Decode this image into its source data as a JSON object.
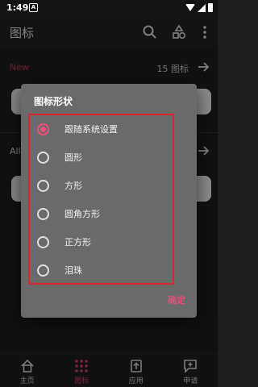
{
  "status_bar": {
    "time": "1:49",
    "notification": "A"
  },
  "app_bar": {
    "title": "图标"
  },
  "background": {
    "new_section": {
      "label": "New",
      "count": "15 图标"
    },
    "all_section": {
      "label": "All"
    }
  },
  "dialog": {
    "title": "图标形状",
    "options": [
      {
        "label": "跟随系统设置",
        "checked": true
      },
      {
        "label": "圆形",
        "checked": false
      },
      {
        "label": "方形",
        "checked": false
      },
      {
        "label": "圆角方形",
        "checked": false
      },
      {
        "label": "正方形",
        "checked": false
      },
      {
        "label": "泪珠",
        "checked": false
      }
    ],
    "ok_label": "确定"
  },
  "bottom_nav": {
    "items": [
      {
        "label": "主页",
        "icon": "home-icon"
      },
      {
        "label": "图标",
        "icon": "grid-icon"
      },
      {
        "label": "应用",
        "icon": "upload-icon"
      },
      {
        "label": "申请",
        "icon": "request-icon"
      }
    ]
  },
  "colors": {
    "accent": "#ef4f78",
    "highlight_box": "#d9262d",
    "dialog_bg": "#6a6a6a",
    "new_label": "#c23a5a"
  }
}
